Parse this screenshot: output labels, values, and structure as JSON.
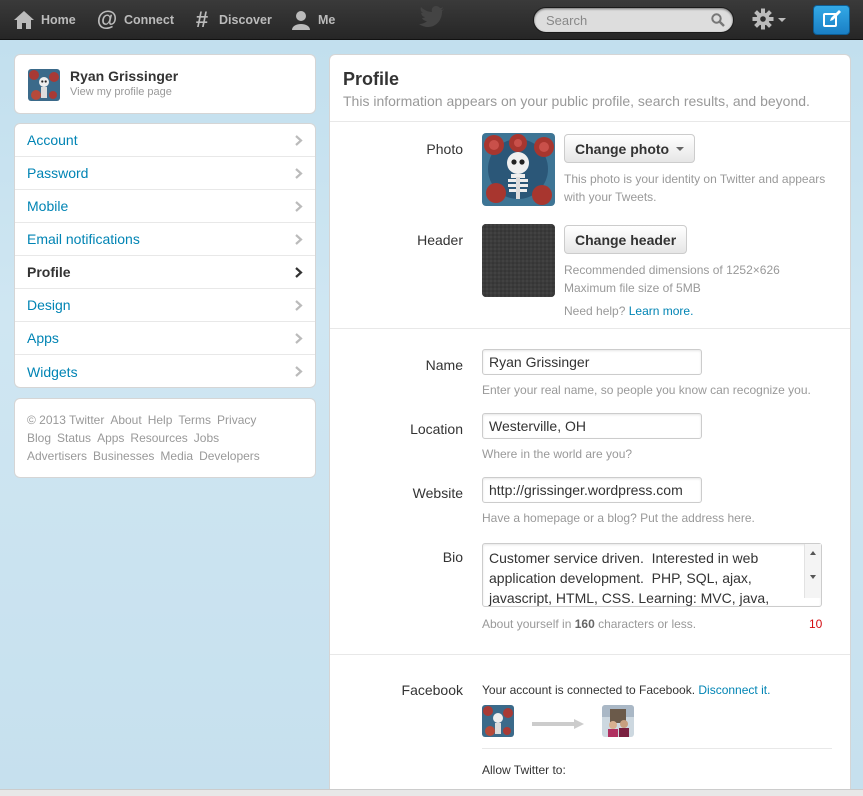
{
  "nav": {
    "home": "Home",
    "connect": "Connect",
    "discover": "Discover",
    "me": "Me",
    "search_placeholder": "Search"
  },
  "user": {
    "name": "Ryan Grissinger",
    "profile_link": "View my profile page"
  },
  "menu": [
    {
      "label": "Account"
    },
    {
      "label": "Password"
    },
    {
      "label": "Mobile"
    },
    {
      "label": "Email notifications"
    },
    {
      "label": "Profile",
      "active": true
    },
    {
      "label": "Design"
    },
    {
      "label": "Apps"
    },
    {
      "label": "Widgets"
    }
  ],
  "footer_links": [
    "© 2013 Twitter",
    "About",
    "Help",
    "Terms",
    "Privacy",
    "Blog",
    "Status",
    "Apps",
    "Resources",
    "Jobs",
    "Advertisers",
    "Businesses",
    "Media",
    "Developers"
  ],
  "profile": {
    "title": "Profile",
    "subtitle": "This information appears on your public profile, search results, and beyond.",
    "photo_label": "Photo",
    "change_photo": "Change photo",
    "photo_hint_1": "This photo is your identity on Twitter and appears",
    "photo_hint_2": "with your Tweets.",
    "header_label": "Header",
    "change_header": "Change header",
    "header_hint_1": "Recommended dimensions of 1252×626",
    "header_hint_2": "Maximum file size of 5MB",
    "need_help": "Need help?",
    "learn_more": "Learn more.",
    "name_label": "Name",
    "name_value": "Ryan Grissinger",
    "name_hint": "Enter your real name, so people you know can recognize you.",
    "location_label": "Location",
    "location_value": "Westerville, OH",
    "location_hint": "Where in the world are you?",
    "website_label": "Website",
    "website_value": "http://grissinger.wordpress.com",
    "website_hint": "Have a homepage or a blog? Put the address here.",
    "bio_label": "Bio",
    "bio_value": "Customer service driven.  Interested in web application development.  PHP, SQL, ajax, javascript, HTML, CSS. Learning: MVC, java, ruby, linux, &",
    "bio_hint_pre": "About yourself in ",
    "bio_hint_num": "160",
    "bio_hint_post": " characters or less.",
    "bio_count": "10",
    "facebook_label": "Facebook",
    "facebook_text": "Your account is connected to Facebook.",
    "disconnect": "Disconnect it.",
    "allow_label": "Allow Twitter to:"
  },
  "colors": {
    "link": "#0084b4",
    "topbar": "#2b2b2b",
    "background": "#c0deed",
    "count_red": "#d40d12"
  }
}
